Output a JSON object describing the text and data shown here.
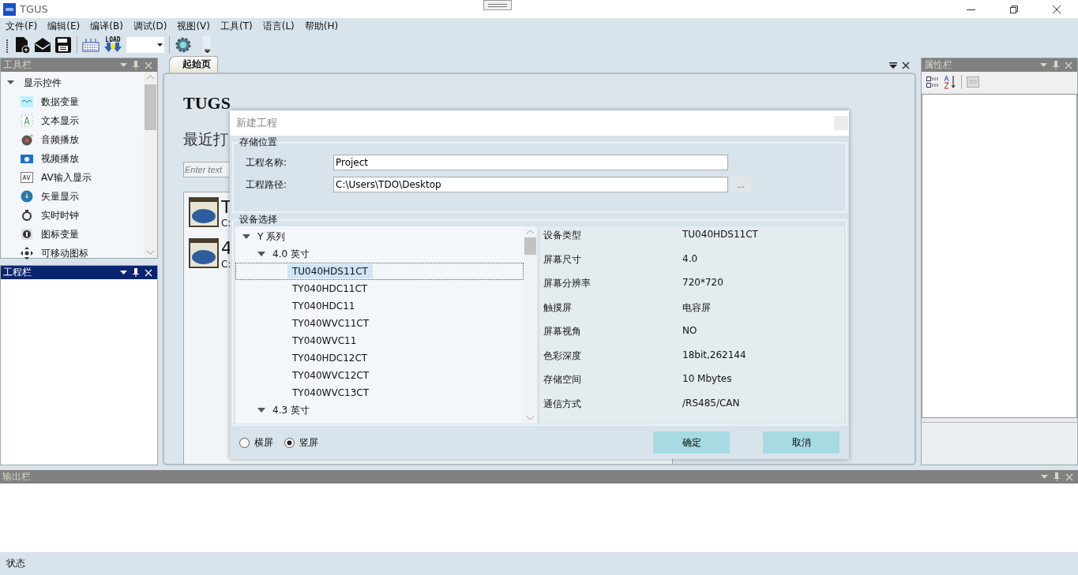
{
  "window": {
    "title": "TGUS"
  },
  "menu": [
    "文件(F)",
    "编辑(E)",
    "编译(B)",
    "调试(D)",
    "视图(V)",
    "工具(T)",
    "语言(L)",
    "帮助(H)"
  ],
  "toolbar": {
    "load_label": "LOAD"
  },
  "toolbox": {
    "title": "工具栏",
    "active": false,
    "groups": [
      {
        "label": "显示控件",
        "expanded": true,
        "children": [
          {
            "label": "数据变量",
            "kind": "wave"
          },
          {
            "label": "文本显示",
            "kind": "text"
          },
          {
            "label": "音频播放",
            "kind": "audio"
          },
          {
            "label": "视频播放",
            "kind": "video"
          },
          {
            "label": "AV输入显示",
            "kind": "av"
          },
          {
            "label": "矢量显示",
            "kind": "vector"
          },
          {
            "label": "实时时钟",
            "kind": "clock"
          },
          {
            "label": "图标变量",
            "kind": "iconvar"
          },
          {
            "label": "可移动图标",
            "kind": "move"
          }
        ]
      }
    ]
  },
  "project_panel": {
    "title": "工程栏",
    "active": true
  },
  "tabs": [
    {
      "label": "起始页",
      "selected": true
    }
  ],
  "start_page": {
    "heading": "TUGS",
    "recent_title": "最近打",
    "search": {
      "placeholder": "Enter text"
    },
    "recent": [
      {
        "name": "T",
        "path": "C:"
      },
      {
        "name": "4",
        "path": "C:"
      }
    ]
  },
  "properties": {
    "title": "属性栏",
    "active": false
  },
  "output": {
    "title": "输出栏",
    "active": false
  },
  "status_bar": "状态",
  "dialog": {
    "title": "新建工程",
    "storage": {
      "title": "存储位置",
      "fields": [
        {
          "label": "工程名称:",
          "value": "Project"
        },
        {
          "label": "工程路径:",
          "value": "C:\\Users\\TDO\\Desktop",
          "browse": "..."
        }
      ]
    },
    "device": {
      "title": "设备选择",
      "tree": [
        {
          "label": "Y 系列",
          "expanded": true,
          "children": [
            {
              "label": "4.0 英寸",
              "expanded": true,
              "children": [
                {
                  "label": "TU040HDS11CT",
                  "selected": true
                },
                {
                  "label": "TY040HDC11CT",
                  "selected": false
                },
                {
                  "label": "TY040HDC11",
                  "selected": false
                },
                {
                  "label": "TY040WVC11CT",
                  "selected": false
                },
                {
                  "label": "TY040WVC11",
                  "selected": false
                },
                {
                  "label": "TY040HDC12CT",
                  "selected": false
                },
                {
                  "label": "TY040WVC12CT",
                  "selected": false
                },
                {
                  "label": "TY040WVC13CT",
                  "selected": false
                }
              ]
            },
            {
              "label": "4.3 英寸",
              "expanded": true
            }
          ]
        }
      ],
      "details": [
        {
          "label": "设备类型",
          "value": "TU040HDS11CT"
        },
        {
          "label": "屏幕尺寸",
          "value": "4.0"
        },
        {
          "label": "屏幕分辨率",
          "value": "720*720"
        },
        {
          "label": "触摸屏",
          "value": "电容屏"
        },
        {
          "label": "屏幕视角",
          "value": "NO"
        },
        {
          "label": "色彩深度",
          "value": "18bit,262144"
        },
        {
          "label": "存储空间",
          "value": "10 Mbytes"
        },
        {
          "label": "通信方式",
          "value": "/RS485/CAN"
        }
      ]
    },
    "orientation": [
      {
        "label": "横屏",
        "selected": false
      },
      {
        "label": "竖屏",
        "selected": true
      }
    ],
    "buttons": [
      "确定",
      "取消"
    ]
  }
}
